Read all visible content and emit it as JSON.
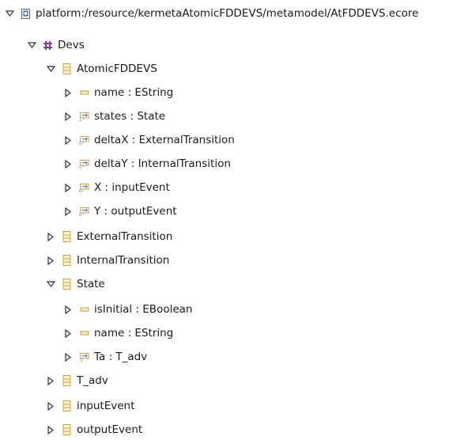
{
  "tree": {
    "root": {
      "label": "platform:/resource/kermetaAtomicFDDEVS/metamodel/AtFDDEVS.ecore",
      "icon": "ecore-resource-icon",
      "expanded": true
    },
    "package": {
      "label": "Devs",
      "icon": "epackage-icon",
      "expanded": true
    },
    "class_atomic": {
      "label": "AtomicFDDEVS",
      "icon": "eclass-icon",
      "expanded": true
    },
    "atomic_name": {
      "label": "name : EString",
      "icon": "eattribute-icon",
      "expanded": false
    },
    "atomic_states": {
      "label": "states : State",
      "icon": "ereference-containment-many-icon",
      "expanded": false
    },
    "atomic_deltax": {
      "label": "deltaX : ExternalTransition",
      "icon": "ereference-containment-icon",
      "expanded": false
    },
    "atomic_deltay": {
      "label": "deltaY : InternalTransition",
      "icon": "ereference-containment-icon",
      "expanded": false
    },
    "atomic_x": {
      "label": "X : inputEvent",
      "icon": "ereference-containment-icon",
      "expanded": false
    },
    "atomic_y": {
      "label": "Y : outputEvent",
      "icon": "ereference-containment-icon",
      "expanded": false
    },
    "class_external": {
      "label": "ExternalTransition",
      "icon": "eclass-icon",
      "expanded": false
    },
    "class_internal": {
      "label": "InternalTransition",
      "icon": "eclass-icon",
      "expanded": false
    },
    "class_state": {
      "label": "State",
      "icon": "eclass-icon",
      "expanded": true
    },
    "state_isinitial": {
      "label": "isInitial : EBoolean",
      "icon": "eattribute-icon",
      "expanded": false
    },
    "state_name": {
      "label": "name : EString",
      "icon": "eattribute-icon",
      "expanded": false
    },
    "state_ta": {
      "label": "Ta : T_adv",
      "icon": "ereference-single-icon",
      "expanded": false
    },
    "class_tadv": {
      "label": "T_adv",
      "icon": "eclass-icon",
      "expanded": false
    },
    "class_inputevent": {
      "label": "inputEvent",
      "icon": "eclass-icon",
      "expanded": false
    },
    "class_outputevent": {
      "label": "outputEvent",
      "icon": "eclass-icon",
      "expanded": false
    }
  },
  "colors": {
    "eclass": "#c8a034",
    "eattribute": "#c89628",
    "epackage": "#8a3aa0",
    "ereference": "#3c6fb0",
    "twisty": "#333333"
  }
}
